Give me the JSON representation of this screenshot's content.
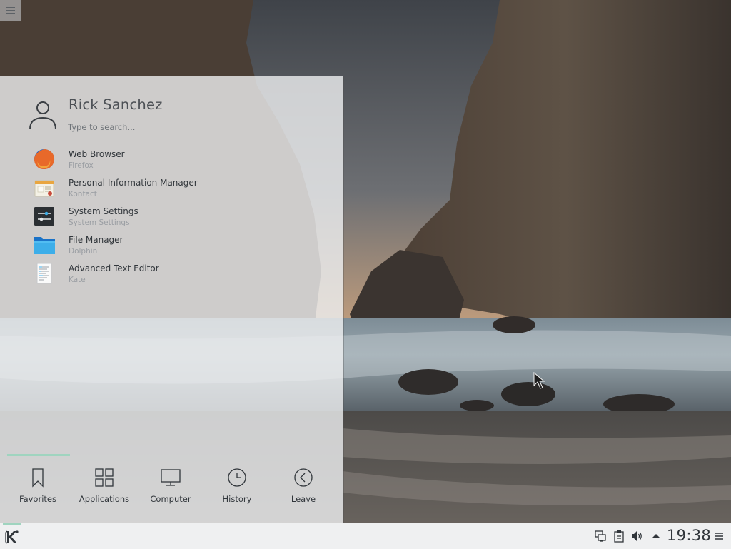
{
  "launcher": {
    "user_name": "Rick Sanchez",
    "search_placeholder": "Type to search...",
    "favorites": [
      {
        "name": "Web Browser",
        "app": "Firefox",
        "icon": "firefox-icon"
      },
      {
        "name": "Personal Information Manager",
        "app": "Kontact",
        "icon": "kontact-icon"
      },
      {
        "name": "System Settings",
        "app": "System Settings",
        "icon": "system-settings-icon"
      },
      {
        "name": "File Manager",
        "app": "Dolphin",
        "icon": "folder-icon"
      },
      {
        "name": "Advanced Text Editor",
        "app": "Kate",
        "icon": "text-editor-icon"
      }
    ],
    "tabs": [
      {
        "label": "Favorites",
        "icon": "bookmark-icon",
        "active": true
      },
      {
        "label": "Applications",
        "icon": "grid-icon",
        "active": false
      },
      {
        "label": "Computer",
        "icon": "monitor-icon",
        "active": false
      },
      {
        "label": "History",
        "icon": "clock-icon",
        "active": false
      },
      {
        "label": "Leave",
        "icon": "back-arrow-icon",
        "active": false
      }
    ]
  },
  "taskbar": {
    "clock": "19:38",
    "tray_icons": [
      "network-icon",
      "clipboard-icon",
      "volume-icon",
      "expand-tray-icon"
    ]
  },
  "colors": {
    "accent": "#9fd4bf",
    "panel_bg": "#eff0f1",
    "text": "#31363b",
    "muted_text": "#9a9ea3"
  }
}
